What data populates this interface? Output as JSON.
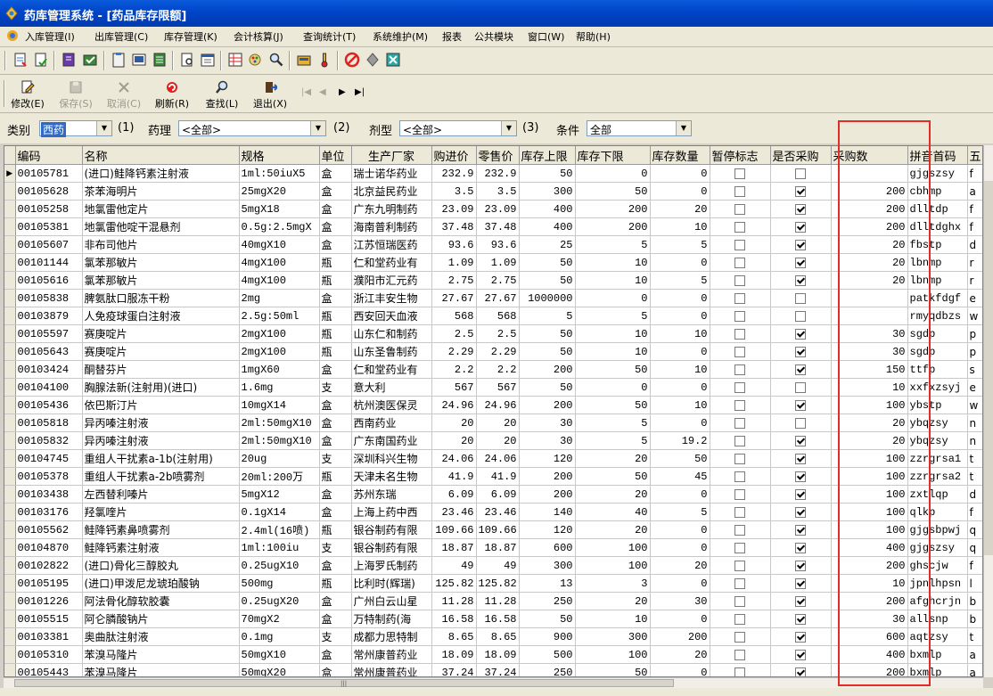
{
  "window": {
    "title": "药库管理系统 - [药品库存限额]"
  },
  "menu": [
    "入库管理(I)",
    "出库管理(C)",
    "库存管理(K)",
    "会计核算(J)",
    "查询统计(T)",
    "系统维护(M)",
    "报表",
    "公共模块",
    "窗口(W)",
    "帮助(H)"
  ],
  "toolbar2": {
    "modify": "修改(E)",
    "save": "保存(S)",
    "cancel": "取消(C)",
    "refresh": "刷新(R)",
    "find": "查找(L)",
    "exit": "退出(X)"
  },
  "filters": {
    "category_label": "类别",
    "category_value": "西药",
    "num1": "(1)",
    "pharm_label": "药理",
    "pharm_value": "<全部>",
    "num2": "(2)",
    "form_label": "剂型",
    "form_value": "<全部>",
    "num3": "(3)",
    "cond_label": "条件",
    "cond_value": "全部"
  },
  "table": {
    "headers": [
      "编码",
      "名称",
      "规格",
      "单位",
      "生产厂家",
      "购进价",
      "零售价",
      "库存上限",
      "库存下限",
      "库存数量",
      "暂停标志",
      "是否采购",
      "采购数",
      "拼音首码",
      "五"
    ],
    "rows": [
      [
        "00105781",
        "(进口)鲑降钙素注射液",
        "1ml:50iuX5",
        "盒",
        "瑞士诺华药业",
        "232.9",
        "232.9",
        "50",
        "0",
        "0",
        false,
        false,
        "",
        "gjgszsy",
        "f"
      ],
      [
        "00105628",
        "茶苯海明片",
        "25mgX20",
        "盒",
        "北京益民药业",
        "3.5",
        "3.5",
        "300",
        "50",
        "0",
        false,
        true,
        "200",
        "cbhmp",
        "a"
      ],
      [
        "00105258",
        "地氯雷他定片",
        "5mgX18",
        "盒",
        "广东九明制药",
        "23.09",
        "23.09",
        "400",
        "200",
        "20",
        false,
        true,
        "200",
        "dlltdp",
        "f"
      ],
      [
        "00105381",
        "地氯雷他啶干混悬剂",
        "0.5g:2.5mgX",
        "盒",
        "海南普利制药",
        "37.48",
        "37.48",
        "400",
        "200",
        "10",
        false,
        true,
        "200",
        "dlltdghx",
        "f"
      ],
      [
        "00105607",
        "非布司他片",
        "40mgX10",
        "盒",
        "江苏恒瑞医药",
        "93.6",
        "93.6",
        "25",
        "5",
        "5",
        false,
        true,
        "20",
        "fbstp",
        "d"
      ],
      [
        "00101144",
        "氯苯那敏片",
        "4mgX100",
        "瓶",
        "仁和堂药业有",
        "1.09",
        "1.09",
        "50",
        "10",
        "0",
        false,
        true,
        "20",
        "lbnmp",
        "r"
      ],
      [
        "00105616",
        "氯苯那敏片",
        "4mgX100",
        "瓶",
        "濮阳市汇元药",
        "2.75",
        "2.75",
        "50",
        "10",
        "5",
        false,
        true,
        "20",
        "lbnmp",
        "r"
      ],
      [
        "00105838",
        "脾氨肽口服冻干粉",
        "2mg",
        "盒",
        "浙江丰安生物",
        "27.67",
        "27.67",
        "1000000",
        "0",
        "0",
        false,
        false,
        "",
        "patkfdgf",
        "e"
      ],
      [
        "00103879",
        "人免疫球蛋白注射液",
        "2.5g:50ml",
        "瓶",
        "西安回天血液",
        "568",
        "568",
        "5",
        "5",
        "0",
        false,
        false,
        "",
        "rmyqdbzs",
        "w"
      ],
      [
        "00105597",
        "赛庚啶片",
        "2mgX100",
        "瓶",
        "山东仁和制药",
        "2.5",
        "2.5",
        "50",
        "10",
        "10",
        false,
        true,
        "30",
        "sgdp",
        "p"
      ],
      [
        "00105643",
        "赛庚啶片",
        "2mgX100",
        "瓶",
        "山东圣鲁制药",
        "2.29",
        "2.29",
        "50",
        "10",
        "0",
        false,
        true,
        "30",
        "sgdp",
        "p"
      ],
      [
        "00103424",
        "酮替芬片",
        "1mgX60",
        "盒",
        "仁和堂药业有",
        "2.2",
        "2.2",
        "200",
        "50",
        "10",
        false,
        true,
        "150",
        "ttfp",
        "s"
      ],
      [
        "00104100",
        "胸腺法新(注射用)(进口)",
        "1.6mg",
        "支",
        "意大利",
        "567",
        "567",
        "50",
        "0",
        "0",
        false,
        false,
        "10",
        "xxfxzsyj",
        "e"
      ],
      [
        "00105436",
        "依巴斯汀片",
        "10mgX14",
        "盒",
        "杭州澳医保灵",
        "24.96",
        "24.96",
        "200",
        "50",
        "10",
        false,
        true,
        "100",
        "ybstp",
        "w"
      ],
      [
        "00105818",
        "异丙嗪注射液",
        "2ml:50mgX10",
        "盒",
        "西南药业",
        "20",
        "20",
        "30",
        "5",
        "0",
        false,
        false,
        "20",
        "ybqzsy",
        "n"
      ],
      [
        "00105832",
        "异丙嗪注射液",
        "2ml:50mgX10",
        "盒",
        "广东南国药业",
        "20",
        "20",
        "30",
        "5",
        "19.2",
        false,
        true,
        "20",
        "ybqzsy",
        "n"
      ],
      [
        "00104745",
        "重组人干扰素a-1b(注射用)",
        "20ug",
        "支",
        "深圳科兴生物",
        "24.06",
        "24.06",
        "120",
        "20",
        "50",
        false,
        true,
        "100",
        "zzrgrsa1",
        "t"
      ],
      [
        "00105378",
        "重组人干扰素a-2b喷雾剂",
        "20ml:200万",
        "瓶",
        "天津未名生物",
        "41.9",
        "41.9",
        "200",
        "50",
        "45",
        false,
        true,
        "100",
        "zzrgrsa2",
        "t"
      ],
      [
        "00103438",
        "左西替利嗪片",
        "5mgX12",
        "盒",
        "苏州东瑞",
        "6.09",
        "6.09",
        "200",
        "20",
        "0",
        false,
        true,
        "100",
        "zxtlqp",
        "d"
      ],
      [
        "00103176",
        "羟氯喹片",
        "0.1gX14",
        "盒",
        "上海上药中西",
        "23.46",
        "23.46",
        "140",
        "40",
        "5",
        false,
        true,
        "100",
        "qlkp",
        "f"
      ],
      [
        "00105562",
        "鲑降钙素鼻喷雾剂",
        "2.4ml(16喷)",
        "瓶",
        "银谷制药有限",
        "109.66",
        "109.66",
        "120",
        "20",
        "0",
        false,
        true,
        "100",
        "gjgsbpwj",
        "q"
      ],
      [
        "00104870",
        "鲑降钙素注射液",
        "1ml:100iu",
        "支",
        "银谷制药有限",
        "18.87",
        "18.87",
        "600",
        "100",
        "0",
        false,
        true,
        "400",
        "gjgszsy",
        "q"
      ],
      [
        "00102822",
        "(进口)骨化三醇胶丸",
        "0.25ugX10",
        "盒",
        "上海罗氏制药",
        "49",
        "49",
        "300",
        "100",
        "20",
        false,
        true,
        "200",
        "ghscjw",
        "f"
      ],
      [
        "00105195",
        "(进口)甲泼尼龙琥珀酸钠",
        "500mg",
        "瓶",
        "比利时(辉瑞)",
        "125.82",
        "125.82",
        "13",
        "3",
        "0",
        false,
        true,
        "10",
        "jpnlhpsn",
        "l"
      ],
      [
        "00101226",
        "阿法骨化醇软胶囊",
        "0.25ugX20",
        "盒",
        "广州白云山星",
        "11.28",
        "11.28",
        "250",
        "20",
        "30",
        false,
        true,
        "200",
        "afghcrjn",
        "b"
      ],
      [
        "00105515",
        "阿仑膦酸钠片",
        "70mgX2",
        "盒",
        "万特制药(海",
        "16.58",
        "16.58",
        "50",
        "10",
        "0",
        false,
        true,
        "30",
        "allsnp",
        "b"
      ],
      [
        "00103381",
        "奥曲肽注射液",
        "0.1mg",
        "支",
        "成都力思特制",
        "8.65",
        "8.65",
        "900",
        "300",
        "200",
        false,
        true,
        "600",
        "aqtzsy",
        "t"
      ],
      [
        "00105310",
        "苯溴马隆片",
        "50mgX10",
        "盒",
        "常州康普药业",
        "18.09",
        "18.09",
        "500",
        "100",
        "20",
        false,
        true,
        "400",
        "bxmlp",
        "a"
      ],
      [
        "00105443",
        "苯溴马隆片",
        "50mgX20",
        "盒",
        "常州康普药业",
        "37.24",
        "37.24",
        "250",
        "50",
        "0",
        false,
        true,
        "200",
        "bxmlp",
        "a"
      ]
    ]
  }
}
